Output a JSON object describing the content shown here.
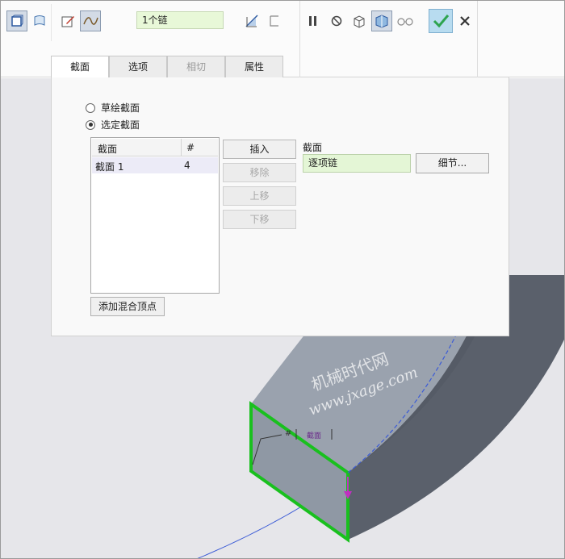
{
  "toolbar": {
    "chain_value": "1个链",
    "icons": [
      "solid-icon",
      "surface-icon",
      "sketch-icon",
      "sweep-curve-icon",
      "flip-area-icon",
      "thicken-icon",
      "pause-icon",
      "no-preview-icon",
      "geometry-preview-icon",
      "verify-preview-icon",
      "glasses-icon",
      "confirm-check-icon",
      "cancel-x-icon"
    ],
    "accent_check_color": "#2ea44f"
  },
  "tabs": [
    {
      "label": "截面",
      "state": "selected"
    },
    {
      "label": "选项",
      "state": "normal"
    },
    {
      "label": "相切",
      "state": "disabled"
    },
    {
      "label": "属性",
      "state": "normal"
    }
  ],
  "panel": {
    "radio_sketch": "草绘截面",
    "radio_selected": "选定截面",
    "selected_option": "选定截面",
    "table": {
      "col_section": "截面",
      "col_count": "#",
      "rows": [
        {
          "name": "截面 1",
          "count": "4"
        }
      ]
    },
    "btn_insert": "插入",
    "btn_remove": "移除",
    "btn_up": "上移",
    "btn_down": "下移",
    "section_label": "截面",
    "section_value": "逐项链",
    "btn_detail": "细节...",
    "btn_add_vertex": "添加混合顶点"
  },
  "viewport": {
    "watermark_line1": "机械时代网",
    "watermark_line2": "www.jxage.com",
    "annotation_hash": "#",
    "annotation_section": "截面",
    "edge_highlight_color": "#19c01e"
  }
}
